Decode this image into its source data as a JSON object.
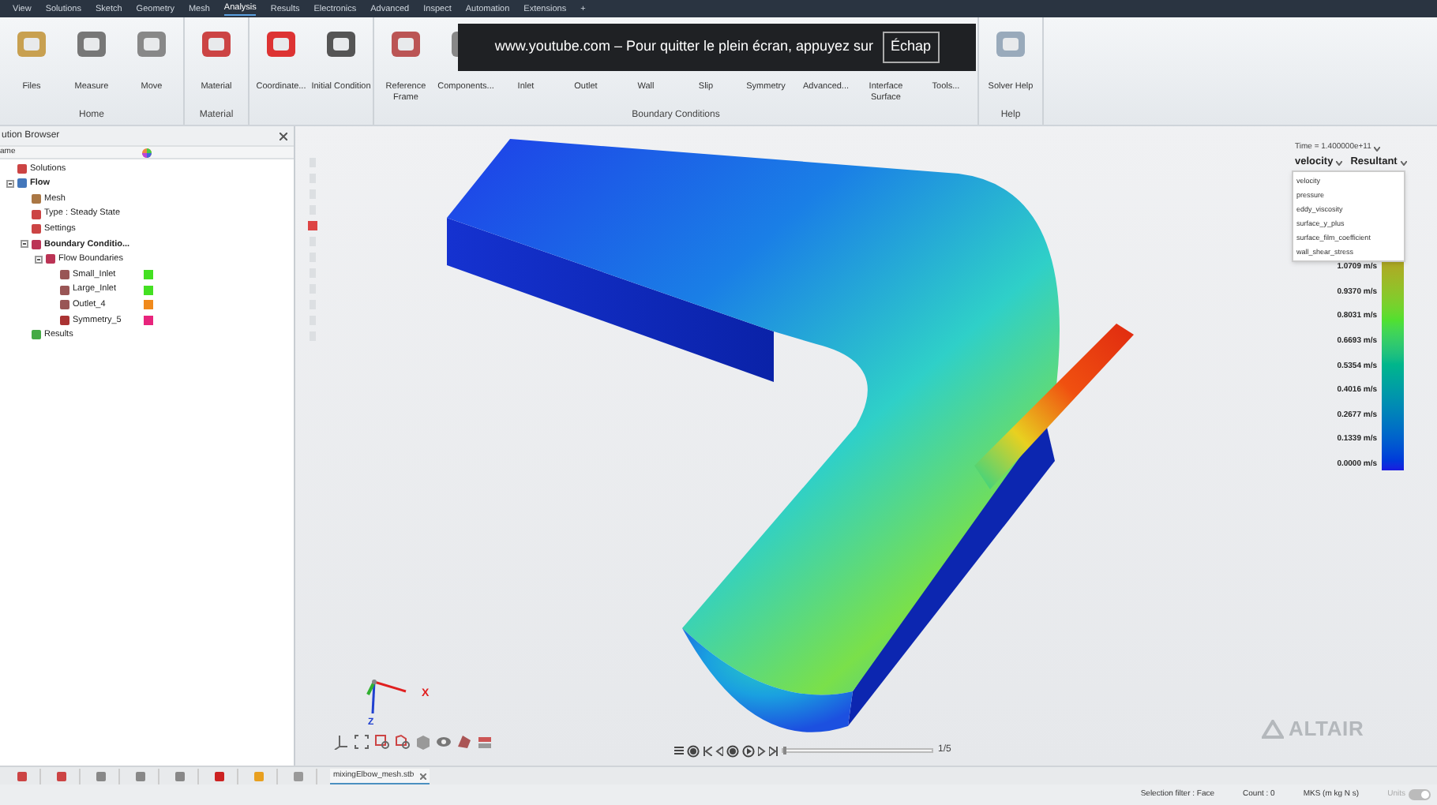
{
  "menu_bar": {
    "items": [
      {
        "label": "View",
        "selected": false
      },
      {
        "label": "Solutions",
        "selected": false
      },
      {
        "label": "Sketch",
        "selected": false
      },
      {
        "label": "Geometry",
        "selected": false
      },
      {
        "label": "Mesh",
        "selected": false
      },
      {
        "label": "Analysis",
        "selected": true
      },
      {
        "label": "Results",
        "selected": false
      },
      {
        "label": "Electronics",
        "selected": false
      },
      {
        "label": "Advanced",
        "selected": false
      },
      {
        "label": "Inspect",
        "selected": false
      },
      {
        "label": "Automation",
        "selected": false
      },
      {
        "label": "Extensions",
        "selected": false
      },
      {
        "label": "+",
        "selected": false
      }
    ]
  },
  "ribbon": {
    "groups": [
      {
        "label": "Home",
        "tools": [
          "Files",
          "Measure",
          "Move"
        ]
      },
      {
        "label": "Material",
        "tools": [
          "Material"
        ]
      },
      {
        "tools": [
          "Coordinate...",
          "Initial Condition"
        ]
      },
      {
        "label": "Boundary Conditions",
        "tools": [
          "Reference Frame",
          "Components...",
          "Inlet",
          "Outlet",
          "Wall",
          "Slip",
          "Symmetry",
          "Advanced...",
          "Interface Surface",
          "Tools..."
        ]
      },
      {
        "label": "Help",
        "tools": [
          "Solver Help"
        ]
      }
    ]
  },
  "fullscreen_notice": {
    "text": "www.youtube.com – Pour quitter le plein écran, appuyez sur",
    "key": "Échap"
  },
  "browser": {
    "title": "ution Browser",
    "column": "ame",
    "tree": [
      {
        "label": "Solutions"
      },
      {
        "label": "Flow",
        "bold": true,
        "expanded": true,
        "children": [
          {
            "label": "Mesh"
          },
          {
            "label": "Type : Steady State"
          },
          {
            "label": "Settings"
          },
          {
            "label": "Boundary Conditio...",
            "bold": true,
            "expanded": true,
            "children": [
              {
                "label": "Flow Boundaries",
                "expanded": true,
                "children": [
                  {
                    "label": "Small_Inlet",
                    "color": "#44e022"
                  },
                  {
                    "label": "Large_Inlet",
                    "color": "#44e022"
                  },
                  {
                    "label": "Outlet_4",
                    "color": "#f08a1c"
                  },
                  {
                    "label": "Symmetry_5",
                    "color": "#e8247c"
                  }
                ]
              }
            ]
          },
          {
            "label": "Results"
          }
        ]
      }
    ]
  },
  "legend": {
    "time": "Time = 1.400000e+11",
    "quantity": "velocity",
    "component": "Resultant",
    "dropdown_items": [
      "velocity",
      "pressure",
      "eddy_viscosity",
      "surface_y_plus",
      "surface_film_coefficient",
      "wall_shear_stress"
    ],
    "labels": [
      "1.0709 m/s",
      "0.9370 m/s",
      "0.8031 m/s",
      "0.6693 m/s",
      "0.5354 m/s",
      "0.4016 m/s",
      "0.2677 m/s",
      "0.1339 m/s",
      "0.0000 m/s"
    ]
  },
  "axes": {
    "x": "X",
    "z": "Z"
  },
  "playback": {
    "frame": "1/5",
    "level": 0
  },
  "brand": "ALTAIR",
  "file_tab": "mixingElbow_mesh.stb",
  "status_bar": {
    "selection_filter": "Selection filter : Face",
    "count": "Count : 0",
    "units": "MKS (m kg N s)",
    "units_toggle": "Units",
    "units_on": true
  }
}
